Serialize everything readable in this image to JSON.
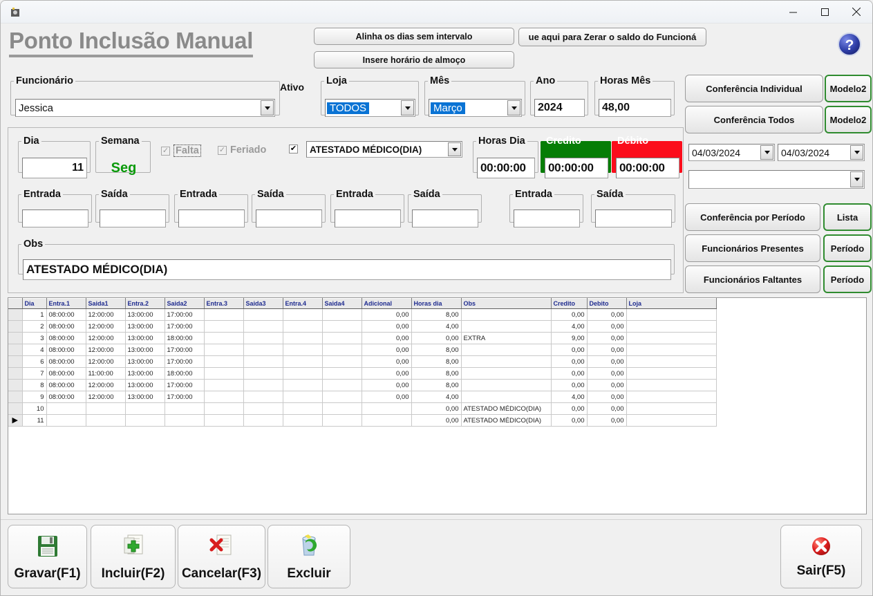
{
  "window": {
    "app_icon": "app-icon",
    "minimize": "—",
    "maximize": "□",
    "close": "✕"
  },
  "header": {
    "title": "Ponto Inclusão Manual",
    "btn_alinha": "Alinha os dias sem intervalo",
    "btn_almoco": "Insere horário de almoço",
    "btn_zerar": "ue aqui para Zerar o saldo do Funcioná",
    "help_icon": "help-icon"
  },
  "filters": {
    "funcionario_label": "Funcionário",
    "funcionario_value": "Jessica",
    "ativo_label": "Ativo",
    "loja_label": "Loja",
    "loja_value": "TODOS",
    "mes_label": "Mês",
    "mes_value": "Março",
    "ano_label": "Ano",
    "ano_value": "2024",
    "horas_mes_label": "Horas Mês",
    "horas_mes_value": "48,00"
  },
  "detail": {
    "dia_label": "Dia",
    "dia_value": "11",
    "semana_label": "Semana",
    "semana_value": "Seg",
    "falta_label": "Falta",
    "falta_checked": "✓",
    "feriado_label": "Feriado",
    "feriado_checked": "✓",
    "ocorrencia_checked": "✔",
    "ocorrencia_value": "ATESTADO MÉDICO(DIA)",
    "horas_dia_label": "Horas Dia",
    "horas_dia_value": "00:00:00",
    "credito_label": "Credito",
    "credito_value": "00:00:00",
    "credito_color": "#067d06",
    "debito_label": "Débito",
    "debito_value": "00:00:00",
    "debito_color": "#fb0d1b",
    "obs_label": "Obs",
    "obs_value": "ATESTADO MÉDICO(DIA)",
    "punch_pairs": [
      {
        "entrada_label": "Entrada",
        "entrada_value": "",
        "saida_label": "Saída",
        "saida_value": ""
      },
      {
        "entrada_label": "Entrada",
        "entrada_value": "",
        "saida_label": "Saída",
        "saida_value": ""
      },
      {
        "entrada_label": "Entrada",
        "entrada_value": "",
        "saida_label": "Saída",
        "saida_value": ""
      },
      {
        "entrada_label": "Entrada",
        "entrada_value": "",
        "saida_label": "Saída",
        "saida_value": ""
      }
    ]
  },
  "reports": {
    "conferencia_individual": "Conferência Individual",
    "modelo2_a": "Modelo2",
    "conferencia_todos": "Conferência Todos",
    "modelo2_b": "Modelo2",
    "date_from": "04/03/2024",
    "date_to": "04/03/2024",
    "extra_select": "",
    "conferencia_periodo": "Conferência por Período",
    "lista": "Lista",
    "funcionarios_presentes": "Funcionários Presentes",
    "periodo_a": "Período",
    "funcionarios_faltantes": "Funcionários Faltantes",
    "periodo_b": "Período"
  },
  "grid": {
    "columns": [
      "Dia",
      "Entra.1",
      "Saida1",
      "Entra.2",
      "Saida2",
      "Entra.3",
      "Saida3",
      "Entra.4",
      "Saida4",
      "Adicional",
      "Horas dia",
      "Obs",
      "Credito",
      "Debito",
      "Loja"
    ],
    "rows": [
      {
        "marker": "",
        "cells": [
          "1",
          "08:00:00",
          "12:00:00",
          "13:00:00",
          "17:00:00",
          "",
          "",
          "",
          "",
          "0,00",
          "8,00",
          "",
          "0,00",
          "0,00",
          ""
        ]
      },
      {
        "marker": "",
        "cells": [
          "2",
          "08:00:00",
          "12:00:00",
          "13:00:00",
          "17:00:00",
          "",
          "",
          "",
          "",
          "0,00",
          "4,00",
          "",
          "4,00",
          "0,00",
          ""
        ]
      },
      {
        "marker": "",
        "cells": [
          "3",
          "08:00:00",
          "12:00:00",
          "13:00:00",
          "18:00:00",
          "",
          "",
          "",
          "",
          "0,00",
          "0,00",
          "EXTRA",
          "9,00",
          "0,00",
          ""
        ]
      },
      {
        "marker": "",
        "cells": [
          "4",
          "08:00:00",
          "12:00:00",
          "13:00:00",
          "17:00:00",
          "",
          "",
          "",
          "",
          "0,00",
          "8,00",
          "",
          "0,00",
          "0,00",
          ""
        ]
      },
      {
        "marker": "",
        "cells": [
          "6",
          "08:00:00",
          "12:00:00",
          "13:00:00",
          "17:00:00",
          "",
          "",
          "",
          "",
          "0,00",
          "8,00",
          "",
          "0,00",
          "0,00",
          ""
        ]
      },
      {
        "marker": "",
        "cells": [
          "7",
          "08:00:00",
          "11:00:00",
          "13:00:00",
          "18:00:00",
          "",
          "",
          "",
          "",
          "0,00",
          "8,00",
          "",
          "0,00",
          "0,00",
          ""
        ]
      },
      {
        "marker": "",
        "cells": [
          "8",
          "08:00:00",
          "12:00:00",
          "13:00:00",
          "17:00:00",
          "",
          "",
          "",
          "",
          "0,00",
          "8,00",
          "",
          "0,00",
          "0,00",
          ""
        ]
      },
      {
        "marker": "",
        "cells": [
          "9",
          "08:00:00",
          "12:00:00",
          "13:00:00",
          "17:00:00",
          "",
          "",
          "",
          "",
          "0,00",
          "4,00",
          "",
          "4,00",
          "0,00",
          ""
        ]
      },
      {
        "marker": "",
        "cells": [
          "10",
          "",
          "",
          "",
          "",
          "",
          "",
          "",
          "",
          "",
          "0,00",
          "ATESTADO MÉDICO(DIA)",
          "0,00",
          "0,00",
          ""
        ]
      },
      {
        "marker": "▶",
        "cells": [
          "11",
          "",
          "",
          "",
          "",
          "",
          "",
          "",
          "",
          "",
          "0,00",
          "ATESTADO MÉDICO(DIA)",
          "0,00",
          "0,00",
          ""
        ]
      }
    ]
  },
  "toolbar": {
    "gravar": "Gravar(F1)",
    "incluir": "Incluir(F2)",
    "cancelar": "Cancelar(F3)",
    "excluir": "Excluir",
    "sair": "Sair(F5)"
  }
}
